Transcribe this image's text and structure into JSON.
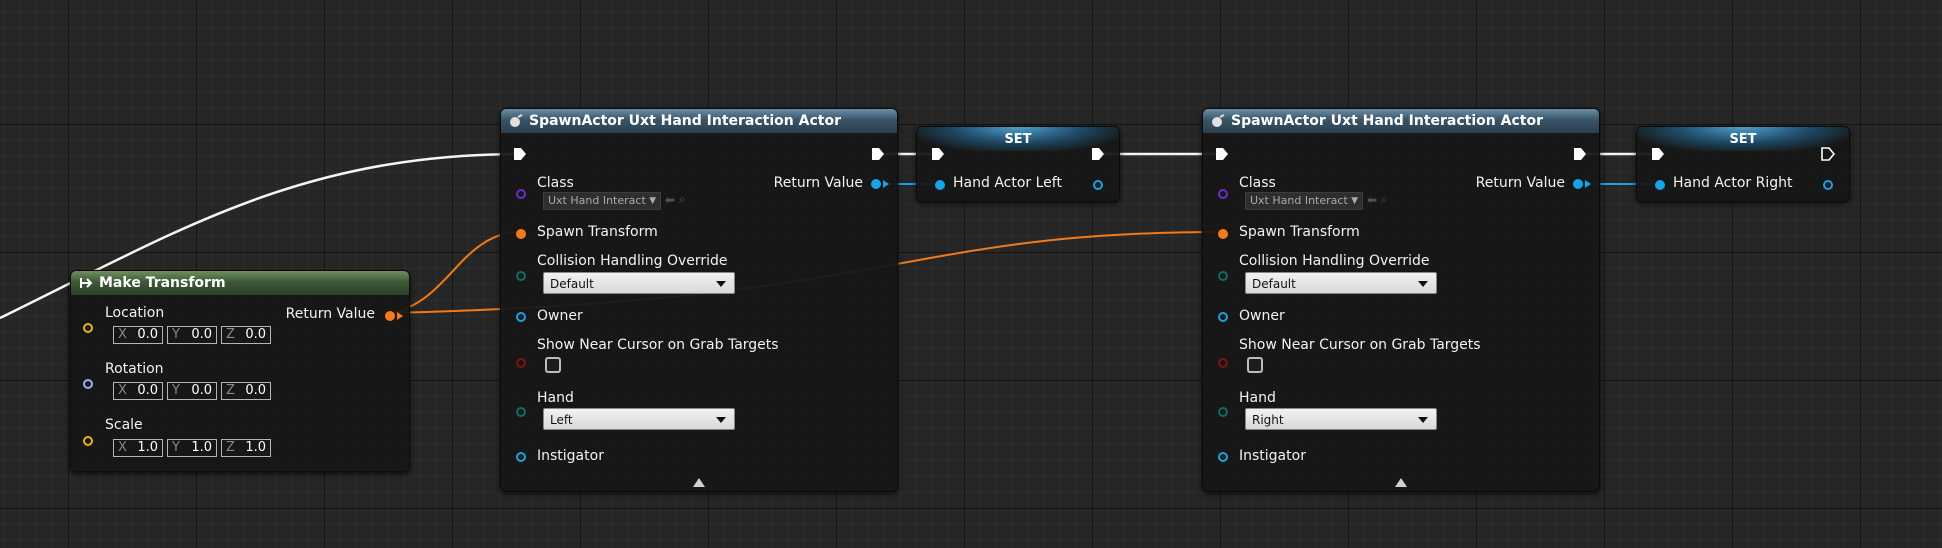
{
  "make_transform": {
    "title": "Make Transform",
    "return_value": "Return Value",
    "inputs": [
      {
        "label": "Location",
        "x": "0.0",
        "y": "0.0",
        "z": "0.0"
      },
      {
        "label": "Rotation",
        "x": "0.0",
        "y": "0.0",
        "z": "0.0"
      },
      {
        "label": "Scale",
        "x": "1.0",
        "y": "1.0",
        "z": "1.0"
      }
    ],
    "axis_labels": {
      "x": "X",
      "y": "Y",
      "z": "Z"
    }
  },
  "spawn_left": {
    "title": "SpawnActor Uxt Hand Interaction Actor",
    "class_label": "Class",
    "class_value": "Uxt Hand Interact",
    "return_value": "Return Value",
    "spawn_transform": "Spawn Transform",
    "collision_label": "Collision Handling Override",
    "collision_value": "Default",
    "owner": "Owner",
    "show_near_cursor": "Show Near Cursor on Grab Targets",
    "hand_label": "Hand",
    "hand_value": "Left",
    "instigator": "Instigator"
  },
  "set_left": {
    "title": "SET",
    "variable": "Hand Actor Left"
  },
  "spawn_right": {
    "title": "SpawnActor Uxt Hand Interaction Actor",
    "class_label": "Class",
    "class_value": "Uxt Hand Interact",
    "return_value": "Return Value",
    "spawn_transform": "Spawn Transform",
    "collision_label": "Collision Handling Override",
    "collision_value": "Default",
    "owner": "Owner",
    "show_near_cursor": "Show Near Cursor on Grab Targets",
    "hand_label": "Hand",
    "hand_value": "Right",
    "instigator": "Instigator"
  },
  "set_right": {
    "title": "SET",
    "variable": "Hand Actor Right"
  },
  "colors": {
    "exec": "#ffffff",
    "object_ref": "#17a3e8",
    "transform": "#f57a1a",
    "class": "#6b2ec2",
    "vector": "#e8b21c",
    "rotator": "#9fa8ff",
    "enum": "#0a6e64",
    "bool": "#8a0f0f",
    "pawn_ref": "#17a3e8"
  }
}
